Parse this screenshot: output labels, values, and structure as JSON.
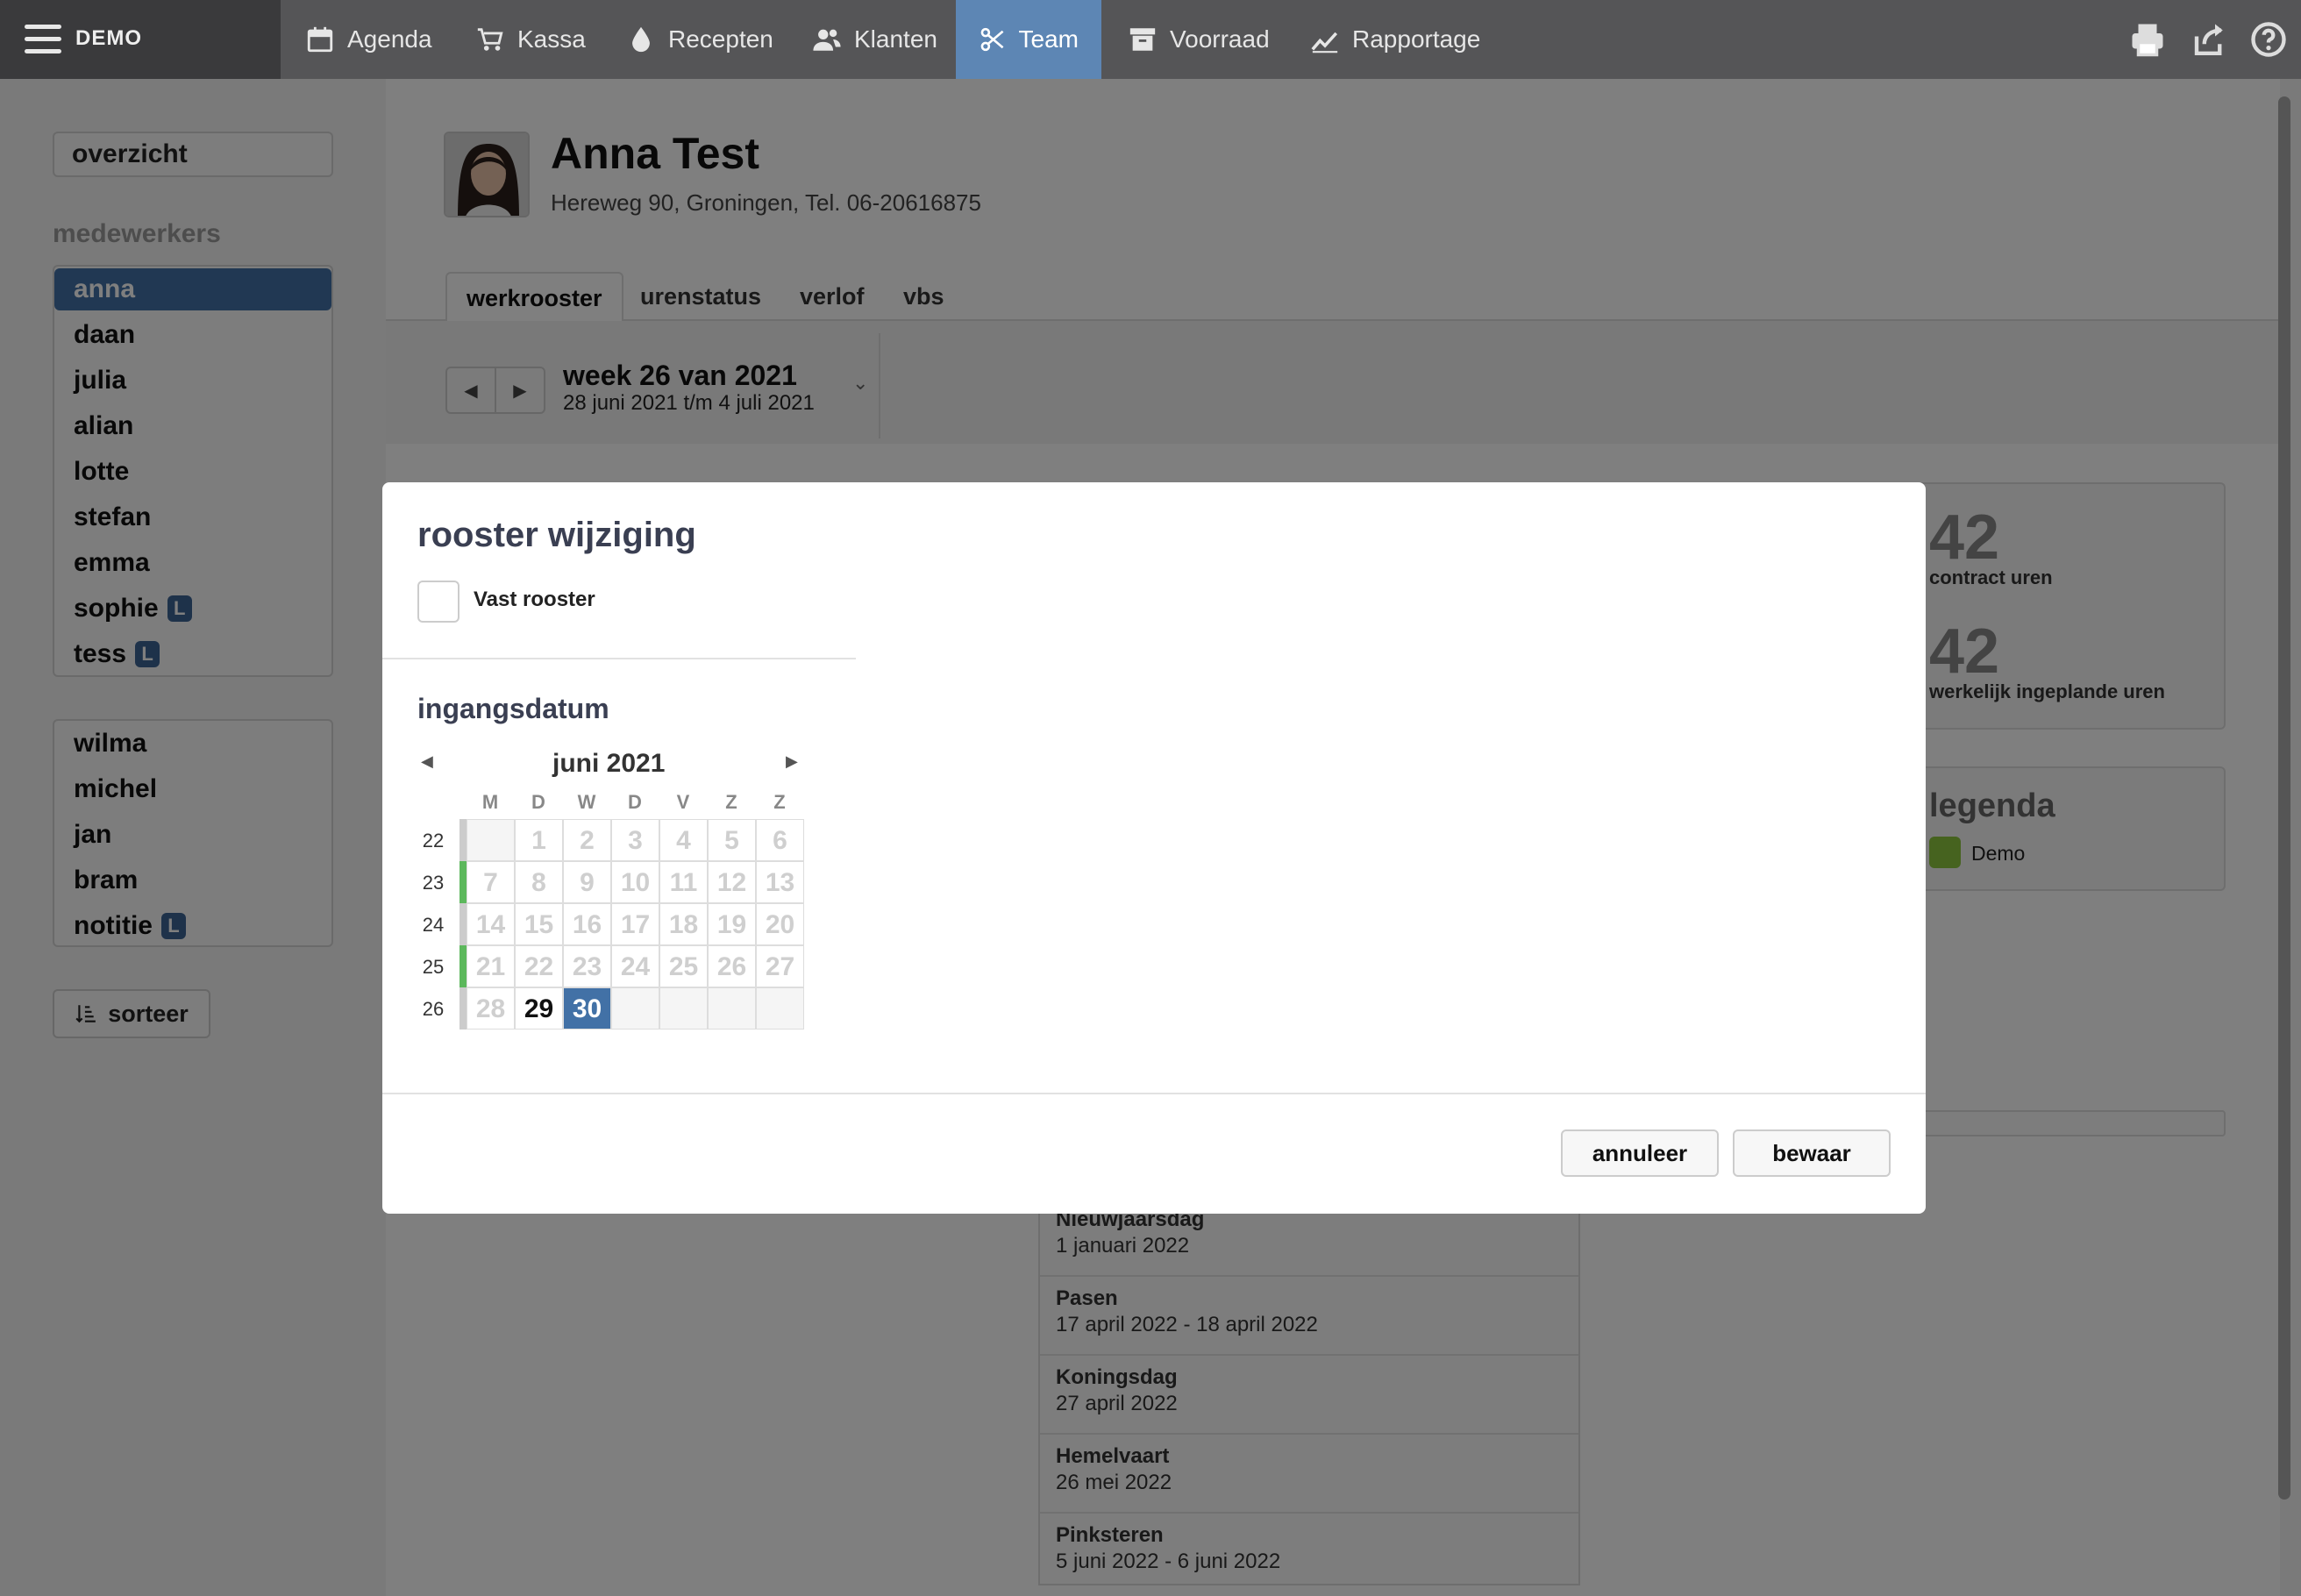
{
  "app": {
    "brand": "DEMO"
  },
  "nav": [
    {
      "label": "Agenda",
      "icon": "calendar-icon"
    },
    {
      "label": "Kassa",
      "icon": "cart-icon"
    },
    {
      "label": "Recepten",
      "icon": "drop-icon"
    },
    {
      "label": "Klanten",
      "icon": "users-icon"
    },
    {
      "label": "Team",
      "icon": "scissors-icon",
      "active": true
    },
    {
      "label": "Voorraad",
      "icon": "archive-icon"
    },
    {
      "label": "Rapportage",
      "icon": "chart-icon"
    }
  ],
  "sidebar": {
    "overview": "overzicht",
    "heading": "medewerkers",
    "group1": [
      {
        "label": "anna",
        "active": true
      },
      {
        "label": "daan"
      },
      {
        "label": "julia"
      },
      {
        "label": "alian"
      },
      {
        "label": "lotte"
      },
      {
        "label": "stefan"
      },
      {
        "label": "emma"
      },
      {
        "label": "sophie",
        "badge": "L"
      },
      {
        "label": "tess",
        "badge": "L"
      }
    ],
    "group2": [
      {
        "label": "wilma"
      },
      {
        "label": "michel"
      },
      {
        "label": "jan"
      },
      {
        "label": "bram"
      },
      {
        "label": "notitie",
        "badge": "L"
      }
    ],
    "sort_label": "sorteer"
  },
  "employee": {
    "name": "Anna Test",
    "address": "Hereweg 90, Groningen, Tel. 06-20616875"
  },
  "tabs": [
    {
      "label": "werkrooster",
      "active": true
    },
    {
      "label": "urenstatus"
    },
    {
      "label": "verlof"
    },
    {
      "label": "vbs"
    }
  ],
  "week": {
    "title": "week 26 van 2021",
    "range": "28 juni 2021 t/m 4 juli 2021"
  },
  "stats": {
    "contract_value": "42",
    "contract_label": "contract uren",
    "planned_value": "42",
    "planned_label": "werkelijk ingeplande uren",
    "legend_title": "legenda",
    "legend_item": "Demo",
    "legend_color": "#8cc63f"
  },
  "holidays": [
    {
      "name": "Nieuwjaarsdag",
      "date": "1 januari 2022"
    },
    {
      "name": "Pasen",
      "date": "17 april 2022 - 18 april 2022"
    },
    {
      "name": "Koningsdag",
      "date": "27 april 2022"
    },
    {
      "name": "Hemelvaart",
      "date": "26 mei 2022"
    },
    {
      "name": "Pinksteren",
      "date": "5 juni 2022 - 6 juni 2022"
    }
  ],
  "modal": {
    "title": "rooster wijziging",
    "checkbox_label": "Vast rooster",
    "section_title": "ingangsdatum",
    "cancel_label": "annuleer",
    "save_label": "bewaar",
    "calendar": {
      "month": "juni 2021",
      "weekdays": [
        "M",
        "D",
        "W",
        "D",
        "V",
        "Z",
        "Z"
      ],
      "weeks": [
        {
          "num": "22",
          "marker": null,
          "days": [
            "",
            "1",
            "2",
            "3",
            "4",
            "5",
            "6"
          ]
        },
        {
          "num": "23",
          "marker": "#5cb85c",
          "days": [
            "7",
            "8",
            "9",
            "10",
            "11",
            "12",
            "13"
          ]
        },
        {
          "num": "24",
          "marker": null,
          "days": [
            "14",
            "15",
            "16",
            "17",
            "18",
            "19",
            "20"
          ]
        },
        {
          "num": "25",
          "marker": "#5cb85c",
          "days": [
            "21",
            "22",
            "23",
            "24",
            "25",
            "26",
            "27"
          ]
        },
        {
          "num": "26",
          "marker": null,
          "days": [
            "28",
            "29",
            "30",
            "",
            "",
            "",
            ""
          ]
        }
      ],
      "available_days": [
        "29",
        "30"
      ],
      "selected_day": "30",
      "marker_default_color": "#cccccc"
    }
  },
  "colors": {
    "nav_bg": "#555557",
    "active": "#4271a6"
  }
}
